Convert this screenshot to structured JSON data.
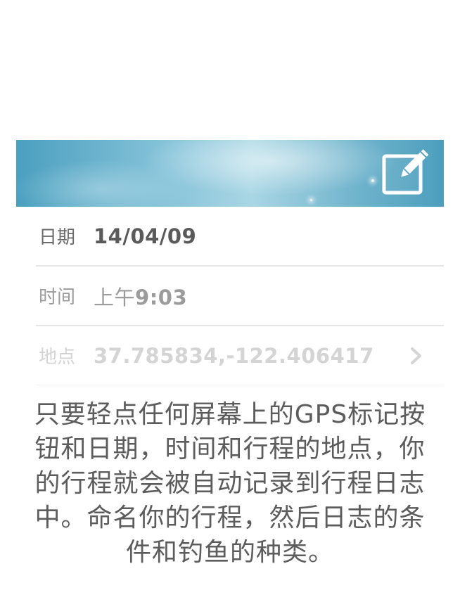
{
  "banner": {
    "edit_icon": "edit-pencil-icon"
  },
  "fields": {
    "date": {
      "label": "日期",
      "value": "14/04/09"
    },
    "time": {
      "label": "时间",
      "prefix": "上午",
      "value": "9:03"
    },
    "location": {
      "label": "地点",
      "value": "37.785834,-122.406417",
      "chevron_icon": "chevron-right-icon"
    }
  },
  "description": "只要轻点任何屏幕上的GPS标记按钮和日期，时间和行程的地点，你的行程就会被自动记录到行程日志中。命名你的行程，然后日志的条件和钓鱼的种类。",
  "colors": {
    "banner_start": "#4a9fbf",
    "banner_mid": "#a9d6e4",
    "text_dark": "#5a5a5a",
    "text_mid": "#9b9b9b",
    "text_light": "#d4d4d4"
  }
}
